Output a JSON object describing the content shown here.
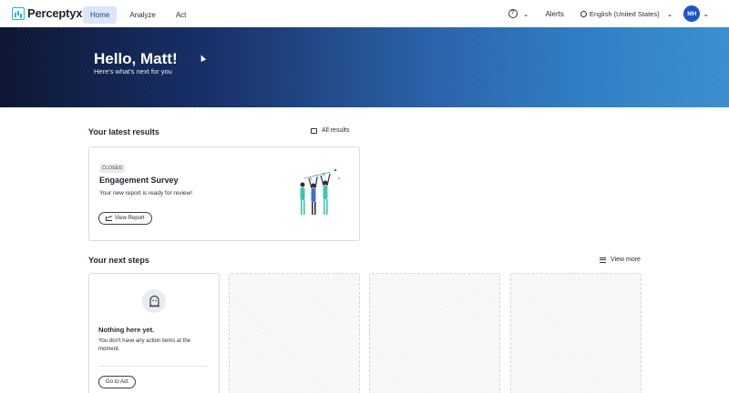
{
  "nav": {
    "logo_text": "Perceptyx",
    "tabs": [
      {
        "label": "Home",
        "active": true
      },
      {
        "label": "Analyze",
        "active": false
      },
      {
        "label": "Act",
        "active": false
      }
    ],
    "help_icon": "?",
    "alerts_label": "Alerts",
    "language_label": "English (United States)",
    "avatar_initials": "MH"
  },
  "hero": {
    "title": "Hello, Matt!",
    "subtitle": "Here's what's next for you"
  },
  "latest_results": {
    "title": "Your latest results",
    "link_label": "All results",
    "card": {
      "badge": "CLOSED",
      "title": "Engagement Survey",
      "description": "Your new report is ready for review!",
      "button_label": "View Report"
    }
  },
  "next_steps": {
    "title": "Your next steps",
    "link_label": "View more",
    "empty_card": {
      "title": "Nothing here yet.",
      "description": "You don't have any action items at the moment.",
      "button_label": "Go to Act"
    }
  },
  "colors": {
    "accent": "#1d56c9",
    "active_tab_bg": "#dbe6f8",
    "logo": "#2bb6c4",
    "illustration_teal": "#3cc6b0",
    "illustration_blue": "#3b6fd0"
  }
}
